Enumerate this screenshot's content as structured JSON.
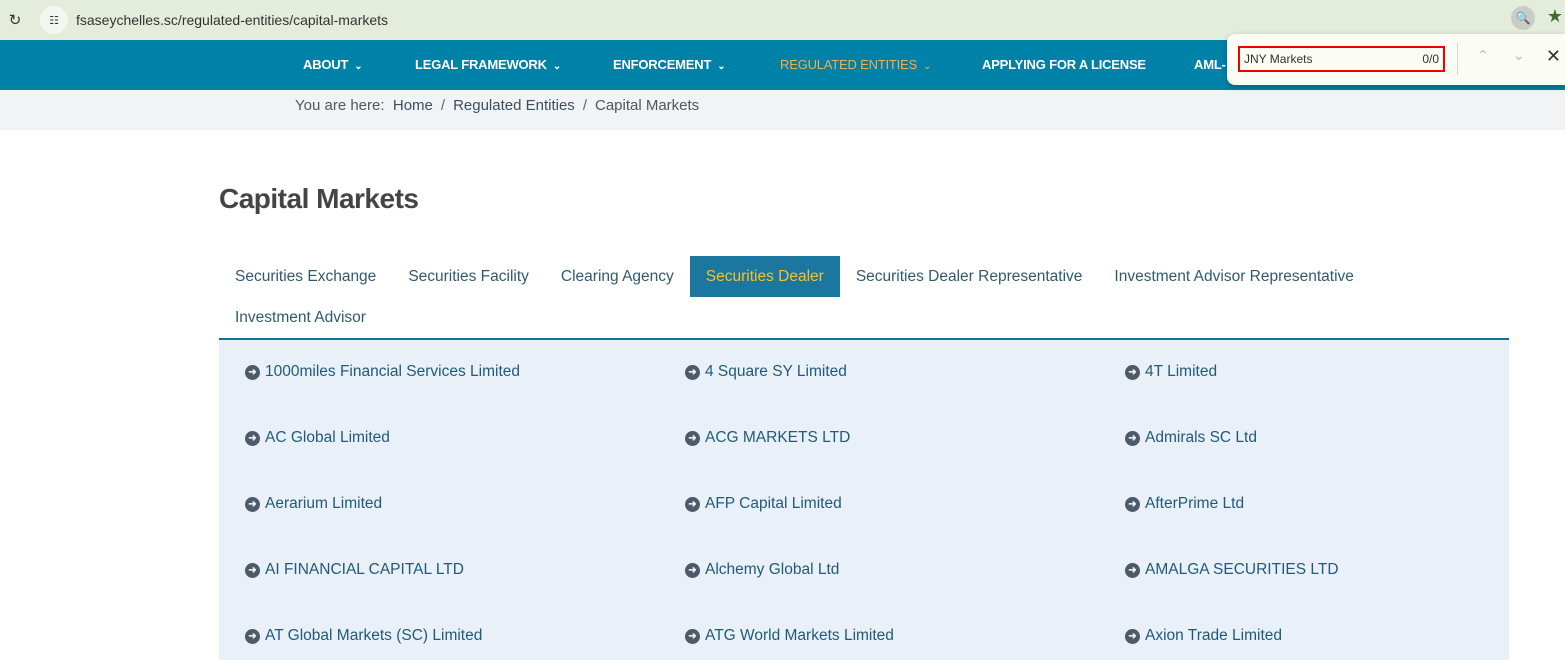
{
  "browser": {
    "url": "fsaseychelles.sc/regulated-entities/capital-markets"
  },
  "nav": {
    "items": [
      {
        "label": "ABOUT",
        "dropdown": true
      },
      {
        "label": "LEGAL FRAMEWORK",
        "dropdown": true
      },
      {
        "label": "ENFORCEMENT",
        "dropdown": true
      },
      {
        "label": "REGULATED ENTITIES",
        "dropdown": true,
        "active": true
      },
      {
        "label": "APPLYING FOR A LICENSE",
        "dropdown": false
      },
      {
        "label": "AML-",
        "dropdown": false
      }
    ]
  },
  "breadcrumb": {
    "prefix": "You are here:",
    "items": [
      "Home",
      "Regulated Entities",
      "Capital Markets"
    ],
    "sep": "/"
  },
  "page_title": "Capital Markets",
  "tabs": [
    "Securities Exchange",
    "Securities Facility",
    "Clearing Agency",
    "Securities Dealer",
    "Securities Dealer Representative",
    "Investment Advisor Representative",
    "Investment Advisor"
  ],
  "active_tab": "Securities Dealer",
  "entities": [
    "1000miles Financial Services Limited",
    "4 Square SY Limited",
    "4T Limited",
    "AC Global Limited",
    "ACG MARKETS LTD",
    "Admirals SC Ltd",
    "Aerarium Limited",
    "AFP Capital Limited",
    "AfterPrime Ltd",
    "AI FINANCIAL CAPITAL LTD",
    "Alchemy Global Ltd",
    "AMALGA SECURITIES LTD",
    "AT Global Markets (SC) Limited",
    "ATG World Markets Limited",
    "Axion Trade Limited"
  ],
  "find_bar": {
    "query": "JNY Markets",
    "count": "0/0"
  },
  "colors": {
    "nav": "#0081a8",
    "active_nav": "#f0b050",
    "active_tab_bg": "#1b77a0",
    "active_tab_text": "#f5c22a",
    "list_bg": "#e9f0f7"
  }
}
